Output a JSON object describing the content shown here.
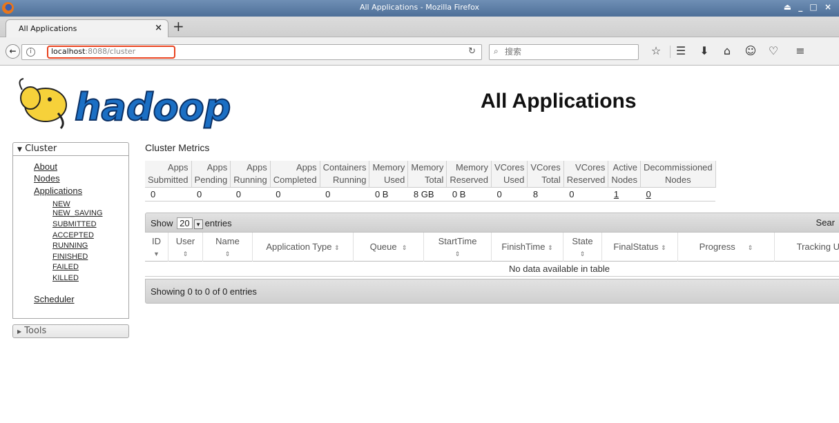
{
  "window": {
    "title": "All Applications - Mozilla Firefox",
    "controls": "⏏ _ □ ×"
  },
  "tab": {
    "label": "All Applications",
    "close": "×",
    "new_tab": "+"
  },
  "nav": {
    "url_host": "localhost",
    "url_rest": ":8088/cluster",
    "search_placeholder": "搜索"
  },
  "logo_text": "hadoop",
  "page_title": "All Applications",
  "sidebar": {
    "cluster_label": "Cluster",
    "links": [
      {
        "label": "About"
      },
      {
        "label": "Nodes"
      },
      {
        "label": "Applications"
      },
      {
        "label": "Scheduler"
      }
    ],
    "states": [
      "NEW",
      "NEW_SAVING",
      "SUBMITTED",
      "ACCEPTED",
      "RUNNING",
      "FINISHED",
      "FAILED",
      "KILLED"
    ],
    "tools_label": "Tools"
  },
  "metrics": {
    "title": "Cluster Metrics",
    "headers": [
      [
        "Apps",
        "Submitted"
      ],
      [
        "Apps",
        "Pending"
      ],
      [
        "Apps",
        "Running"
      ],
      [
        "Apps",
        "Completed"
      ],
      [
        "Containers",
        "Running"
      ],
      [
        "Memory",
        "Used"
      ],
      [
        "Memory",
        "Total"
      ],
      [
        "Memory",
        "Reserved"
      ],
      [
        "VCores",
        "Used"
      ],
      [
        "VCores",
        "Total"
      ],
      [
        "VCores",
        "Reserved"
      ],
      [
        "Active",
        "Nodes"
      ],
      [
        "Decommissioned",
        "Nodes"
      ]
    ],
    "values": [
      "0",
      "0",
      "0",
      "0",
      "0",
      "0 B",
      "8 GB",
      "0 B",
      "0",
      "8",
      "0",
      "1",
      "0"
    ]
  },
  "datatable": {
    "show_label": "Show",
    "entries_count": "20",
    "entries_label": "entries",
    "search_label": "Sear",
    "columns": [
      {
        "l1": "ID",
        "l2": ""
      },
      {
        "l1": "User",
        "l2": ""
      },
      {
        "l1": "Name",
        "l2": ""
      },
      {
        "l1": "Application Type",
        "l2": ""
      },
      {
        "l1": "Queue",
        "l2": ""
      },
      {
        "l1": "StartTime",
        "l2": ""
      },
      {
        "l1": "FinishTime",
        "l2": ""
      },
      {
        "l1": "State",
        "l2": ""
      },
      {
        "l1": "FinalStatus",
        "l2": ""
      },
      {
        "l1": "Progress",
        "l2": ""
      },
      {
        "l1": "Tracking U",
        "l2": ""
      }
    ],
    "empty_message": "No data available in table",
    "info": "Showing 0 to 0 of 0 entries"
  }
}
